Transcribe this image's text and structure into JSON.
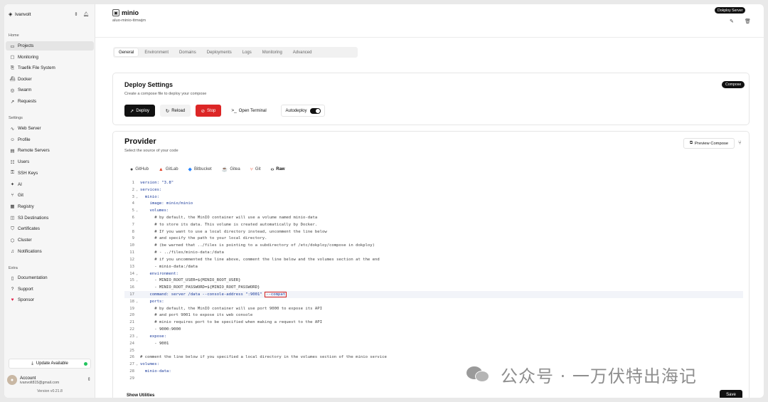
{
  "sidebar": {
    "org_name": "Ivanvolt",
    "sections": {
      "home": "Home",
      "settings": "Settings",
      "extra": "Extra"
    },
    "home_items": [
      {
        "label": "Projects",
        "icon": "folder-icon"
      },
      {
        "label": "Monitoring",
        "icon": "monitor-icon"
      },
      {
        "label": "Traefik File System",
        "icon": "file-icon"
      },
      {
        "label": "Docker",
        "icon": "docker-icon"
      },
      {
        "label": "Swarm",
        "icon": "swarm-icon"
      },
      {
        "label": "Requests",
        "icon": "requests-icon"
      }
    ],
    "settings_items": [
      {
        "label": "Web Server",
        "icon": "activity-icon"
      },
      {
        "label": "Profile",
        "icon": "user-icon"
      },
      {
        "label": "Remote Servers",
        "icon": "server-icon"
      },
      {
        "label": "Users",
        "icon": "users-icon"
      },
      {
        "label": "SSH Keys",
        "icon": "key-icon"
      },
      {
        "label": "AI",
        "icon": "ai-icon"
      },
      {
        "label": "Git",
        "icon": "git-icon"
      },
      {
        "label": "Registry",
        "icon": "registry-icon"
      },
      {
        "label": "S3 Destinations",
        "icon": "database-icon"
      },
      {
        "label": "Certificates",
        "icon": "shield-icon"
      },
      {
        "label": "Cluster",
        "icon": "cluster-icon"
      },
      {
        "label": "Notifications",
        "icon": "bell-icon"
      }
    ],
    "extra_items": [
      {
        "label": "Documentation",
        "icon": "book-icon"
      },
      {
        "label": "Support",
        "icon": "help-icon"
      },
      {
        "label": "Sponsor",
        "icon": "heart-icon"
      }
    ],
    "update_label": "Update Available",
    "account": {
      "title": "Account",
      "email": "ivanvolt815@gmail.com"
    },
    "version": "Version v0.21.8"
  },
  "header": {
    "project_name": "minio",
    "project_slug": "aluo-minio-ttmwjm",
    "server_badge": "Dokploy Server"
  },
  "tabs": [
    {
      "label": "General",
      "active": true
    },
    {
      "label": "Environment",
      "active": false
    },
    {
      "label": "Domains",
      "active": false
    },
    {
      "label": "Deployments",
      "active": false
    },
    {
      "label": "Logs",
      "active": false
    },
    {
      "label": "Monitoring",
      "active": false
    },
    {
      "label": "Advanced",
      "active": false
    }
  ],
  "deploy_settings": {
    "title": "Deploy Settings",
    "subtitle": "Create a compose file to deploy your compose",
    "badge": "Compose",
    "buttons": {
      "deploy": "Deploy",
      "reload": "Reload",
      "stop": "Stop",
      "terminal": "Open Terminal",
      "autodeploy": "Autodeploy"
    },
    "autodeploy_on": true
  },
  "provider": {
    "title": "Provider",
    "subtitle": "Select the source of your code",
    "preview_label": "Preview Compose",
    "tabs": [
      {
        "label": "GitHub",
        "icon": "github-icon",
        "active": false
      },
      {
        "label": "GitLab",
        "icon": "gitlab-icon",
        "active": false
      },
      {
        "label": "Bitbucket",
        "icon": "bitbucket-icon",
        "active": false
      },
      {
        "label": "Gitea",
        "icon": "gitea-icon",
        "active": false
      },
      {
        "label": "Git",
        "icon": "git-icon",
        "active": false
      },
      {
        "label": "Raw",
        "icon": "code-icon",
        "active": true
      }
    ]
  },
  "editor_lines": [
    {
      "n": "1",
      "fold": "",
      "text": "version: \"3.8\""
    },
    {
      "n": "2",
      "fold": "⌄",
      "text": "services:"
    },
    {
      "n": "3",
      "fold": "⌄",
      "text": "  minio:"
    },
    {
      "n": "4",
      "fold": "",
      "text": "    image: minio/minio"
    },
    {
      "n": "5",
      "fold": "⌄",
      "text": "    volumes:"
    },
    {
      "n": "6",
      "fold": "",
      "text": "      # by default, the MinIO container will use a volume named minio-data"
    },
    {
      "n": "7",
      "fold": "",
      "text": "      # to store its data. This volume is created automatically by Docker."
    },
    {
      "n": "8",
      "fold": "",
      "text": "      # If you want to use a local directory instead, uncomment the line below"
    },
    {
      "n": "9",
      "fold": "",
      "text": "      # and specify the path to your local directory."
    },
    {
      "n": "10",
      "fold": "",
      "text": "      # (be warned that ../files is pointing to a subdirectory of /etc/dokploy/compose in dokploy)"
    },
    {
      "n": "11",
      "fold": "",
      "text": "      # - ../files/minio-data:/data"
    },
    {
      "n": "12",
      "fold": "",
      "text": "      # if you uncommented the line above, comment the line below and the volumes section at the end"
    },
    {
      "n": "13",
      "fold": "",
      "text": "      - minio-data:/data"
    },
    {
      "n": "14",
      "fold": "⌄",
      "text": "    environment:"
    },
    {
      "n": "15",
      "fold": "⌄",
      "text": "      - MINIO_ROOT_USER=${MINIO_ROOT_USER}"
    },
    {
      "n": "16",
      "fold": "",
      "text": "      - MINIO_ROOT_PASSWORD=${MINIO_ROOT_PASSWORD}"
    },
    {
      "n": "17",
      "fold": "",
      "text": "    command: server /data --console-address \":9001\" "
    },
    {
      "n": "18",
      "fold": "⌄",
      "text": "    ports:"
    },
    {
      "n": "19",
      "fold": "",
      "text": "      # by default, the MinIO container will use port 9000 to expose its API"
    },
    {
      "n": "20",
      "fold": "",
      "text": "      # and port 9001 to expose its web console"
    },
    {
      "n": "21",
      "fold": "",
      "text": "      # minio requires port to be specified when making a request to the API"
    },
    {
      "n": "22",
      "fold": "",
      "text": "      - 9000:9000"
    },
    {
      "n": "23",
      "fold": "⌄",
      "text": "    expose:"
    },
    {
      "n": "24",
      "fold": "",
      "text": "      - 9001"
    },
    {
      "n": "25",
      "fold": "",
      "text": ""
    },
    {
      "n": "26",
      "fold": "",
      "text": "# comment the line below if you specified a local directory in the volumes section of the minio service"
    },
    {
      "n": "27",
      "fold": "⌄",
      "text": "volumes:"
    },
    {
      "n": "28",
      "fold": "",
      "text": "  minio-data:"
    },
    {
      "n": "29",
      "fold": "",
      "text": ""
    }
  ],
  "highlighted_token": "--compat",
  "footer": {
    "show_utilities": "Show Utilities",
    "save": "Save"
  },
  "watermark": {
    "text": "公众号 · 一万伏特出海记"
  }
}
